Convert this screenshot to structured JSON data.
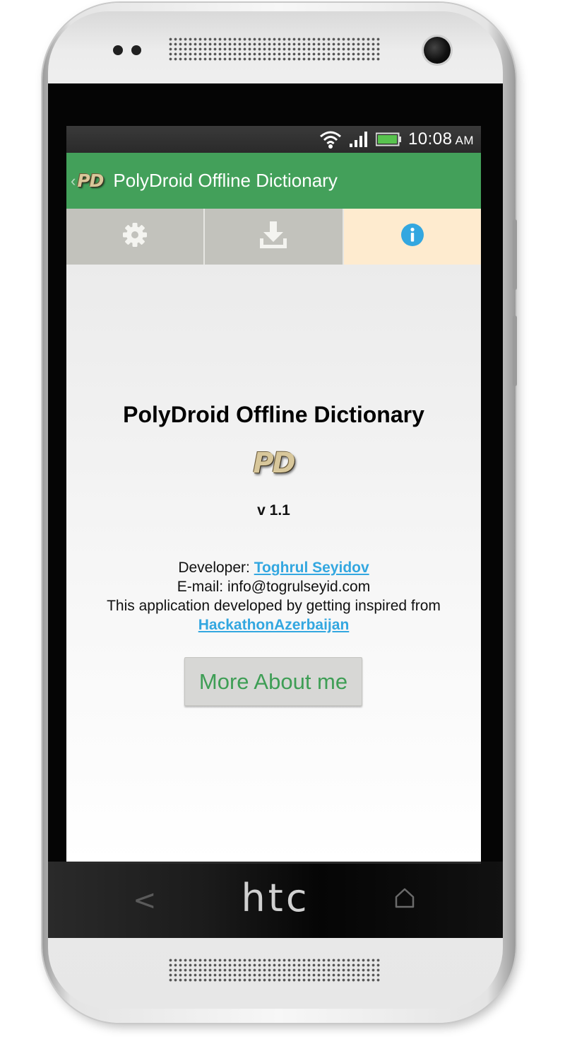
{
  "device": {
    "brand": "htc"
  },
  "status_bar": {
    "time": "10:08",
    "ampm": "AM",
    "battery_color": "#58c24e"
  },
  "action_bar": {
    "logo": "PD",
    "title": "PolyDroid Offline Dictionary",
    "color": "#43a05a"
  },
  "tabs": [
    {
      "icon": "gear-icon",
      "active": false
    },
    {
      "icon": "download-icon",
      "active": false
    },
    {
      "icon": "info-icon",
      "active": true
    }
  ],
  "about": {
    "title": "PolyDroid Offline Dictionary",
    "logo": "PD",
    "version": "v 1.1",
    "developer_label": "Developer: ",
    "developer_name": "Toghrul Seyidov",
    "email_line": "E-mail: info@togrulseyid.com",
    "inspired_line": "This application developed by getting inspired from",
    "inspired_link": "HackathonAzerbaijan",
    "more_button": "More About me",
    "link_color": "#33a7e0"
  }
}
